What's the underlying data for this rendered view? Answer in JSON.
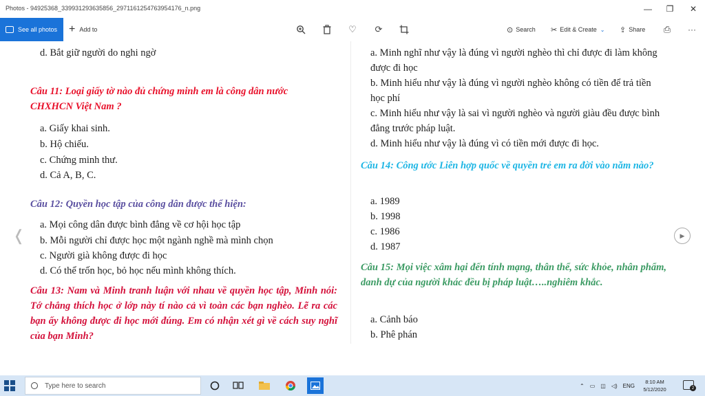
{
  "window": {
    "title": "Photos - 94925368_339931293635856_2971161254763954176_n.png",
    "minimize": "—",
    "maximize": "❐",
    "close": "✕"
  },
  "toolbar": {
    "see_all": "See all photos",
    "add_to": "Add to",
    "search": "Search",
    "edit_create": "Edit & Create",
    "share": "Share",
    "more": "···"
  },
  "left": {
    "prev_option": "d. Bắt giữ người do nghi ngờ",
    "q11": "Câu 11: Loại giấy tờ nào đủ chứng minh em là công dân nước CHXHCN Việt Nam ?",
    "q11_options": [
      "a. Giấy khai sinh.",
      "b. Hộ chiếu.",
      "c. Chứng minh thư.",
      "d. Cả A, B, C."
    ],
    "q12": "Câu 12: Quyền học tập của công dân được thể hiện:",
    "q12_options": [
      "a. Mọi công dân được bình đẳng về cơ hội học tập",
      "b. Mỗi người chỉ được học một ngành nghề mà mình chọn",
      "c. Người già không được đi học",
      "d. Có thể trốn học, bỏ học nếu mình không thích."
    ],
    "q13": "Câu 13: Nam và Minh tranh luận với nhau về quyền học tập, Minh nói: Tớ chẳng thích học ở lớp này tí nào cả vì toàn các bạn nghèo. Lẽ ra các bạn ấy không được đi học mới đúng. Em có nhận xét gì về cách suy nghĩ của bạn Minh?"
  },
  "right": {
    "q13_options": [
      "a. Minh nghĩ như vậy là đúng vì người nghèo thì chỉ được đi làm không được đi học",
      "b. Minh hiểu như vậy là đúng vì người nghèo không có tiền để trả tiền học phí",
      "c. Minh hiểu như vậy là sai vì người nghèo và người giàu đều được bình đẳng trước pháp luật.",
      "d. Minh hiểu như vậy là đúng vì có tiền mới được đi học."
    ],
    "q14": "Câu 14: Công ước Liên hợp quốc về quyền trẻ em ra đời vào năm nào?",
    "q14_options": [
      "a. 1989",
      "b. 1998",
      "c. 1986",
      "d. 1987"
    ],
    "q15": "Câu 15: Mọi việc xâm hại đến tính mạng, thân thể, sức khỏe, nhân phẩm, danh dự của người khác đều bị pháp luật…..nghiêm khắc.",
    "q15_options": [
      "a. Cảnh báo",
      "b. Phê phán"
    ]
  },
  "taskbar": {
    "search_placeholder": "Type here to search",
    "language": "ENG",
    "time": "8:10 AM",
    "date": "5/12/2020",
    "notifications": "2"
  }
}
